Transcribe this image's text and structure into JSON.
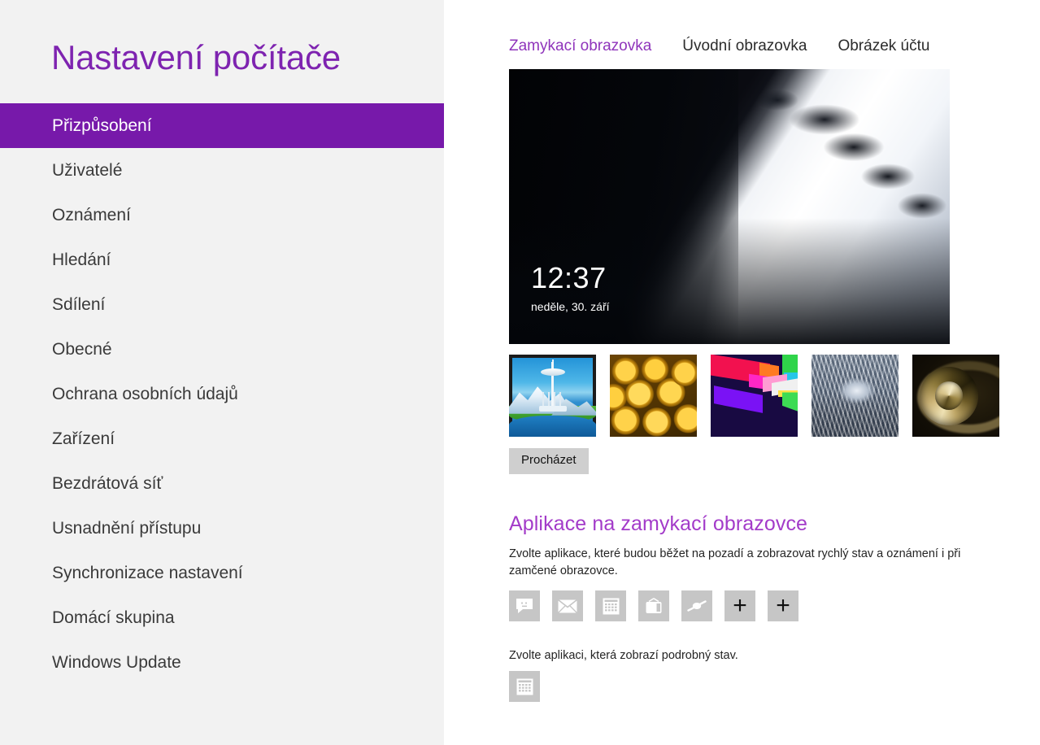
{
  "app": {
    "title": "Nastavení počítače"
  },
  "sidebar": {
    "items": [
      {
        "label": "Přizpůsobení",
        "selected": true
      },
      {
        "label": "Uživatelé",
        "selected": false
      },
      {
        "label": "Oznámení",
        "selected": false
      },
      {
        "label": "Hledání",
        "selected": false
      },
      {
        "label": "Sdílení",
        "selected": false
      },
      {
        "label": "Obecné",
        "selected": false
      },
      {
        "label": "Ochrana osobních údajů",
        "selected": false
      },
      {
        "label": "Zařízení",
        "selected": false
      },
      {
        "label": "Bezdrátová síť",
        "selected": false
      },
      {
        "label": "Usnadnění přístupu",
        "selected": false
      },
      {
        "label": "Synchronizace nastavení",
        "selected": false
      },
      {
        "label": "Domácí skupina",
        "selected": false
      },
      {
        "label": "Windows Update",
        "selected": false
      }
    ]
  },
  "tabs": [
    {
      "label": "Zamykací obrazovka",
      "active": true
    },
    {
      "label": "Úvodní obrazovka",
      "active": false
    },
    {
      "label": "Obrázek účtu",
      "active": false
    }
  ],
  "lock_preview": {
    "image_name": "piano-keys-photo",
    "time": "12:37",
    "date": "neděle, 30. září"
  },
  "thumbnails": [
    {
      "name": "seattle-space-needle",
      "selected": true
    },
    {
      "name": "honeycomb",
      "selected": false
    },
    {
      "name": "abstract-geometric",
      "selected": false
    },
    {
      "name": "motion-blur-tunnel",
      "selected": false
    },
    {
      "name": "nautilus-shell",
      "selected": false
    }
  ],
  "browse": {
    "label": "Procházet"
  },
  "apps_section": {
    "heading": "Aplikace na zamykací obrazovce",
    "description": "Zvolte aplikace, které budou běžet na pozadí a zobrazovat rychlý stav a oznámení i při zamčené obrazovce.",
    "tiles": [
      {
        "icon": "messaging-icon"
      },
      {
        "icon": "mail-icon"
      },
      {
        "icon": "calendar-icon"
      },
      {
        "icon": "video-icon"
      },
      {
        "icon": "weather-icon"
      },
      {
        "icon": "plus-icon",
        "glyph": "+"
      },
      {
        "icon": "plus-icon",
        "glyph": "+"
      }
    ]
  },
  "detail_section": {
    "description": "Zvolte aplikaci, která zobrazí podrobný stav.",
    "tile": {
      "icon": "calendar-icon"
    }
  },
  "colors": {
    "accent_purple": "#7719aa",
    "title_purple": "#7e23b0",
    "tab_active_purple": "#8f34bb",
    "heading_purple": "#a33bc9",
    "sidebar_bg": "#f2f2f2",
    "content_bg": "#ffffff",
    "tile_bg": "#c6c6c6",
    "button_bg": "#cfcfcf"
  }
}
